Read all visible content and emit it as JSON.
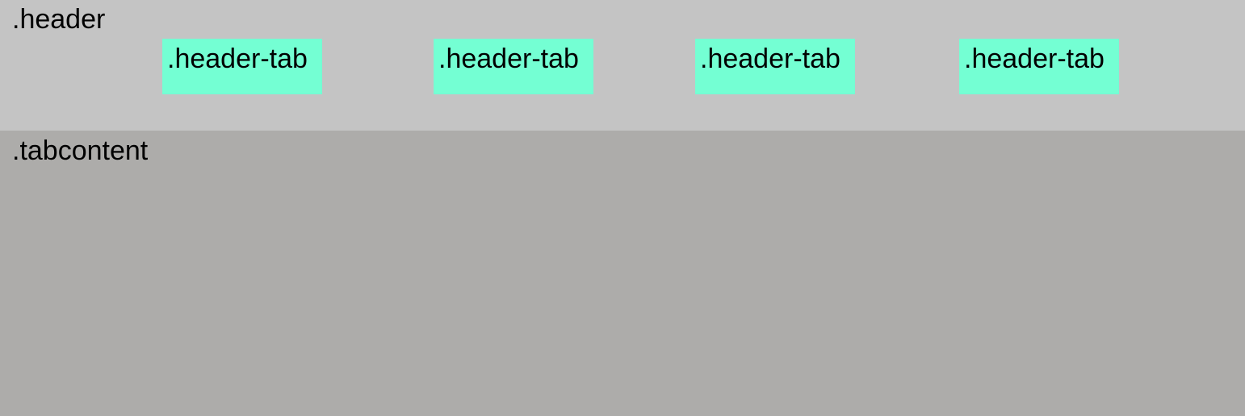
{
  "header": {
    "label": ".header",
    "tabs": [
      {
        "label": ".header-tab"
      },
      {
        "label": ".header-tab"
      },
      {
        "label": ".header-tab"
      },
      {
        "label": ".header-tab"
      }
    ]
  },
  "tabcontent": {
    "label": ".tabcontent"
  },
  "colors": {
    "header_bg": "#c4c4c4",
    "tab_bg": "#74ffd3",
    "tabcontent_bg": "#adacaa"
  }
}
